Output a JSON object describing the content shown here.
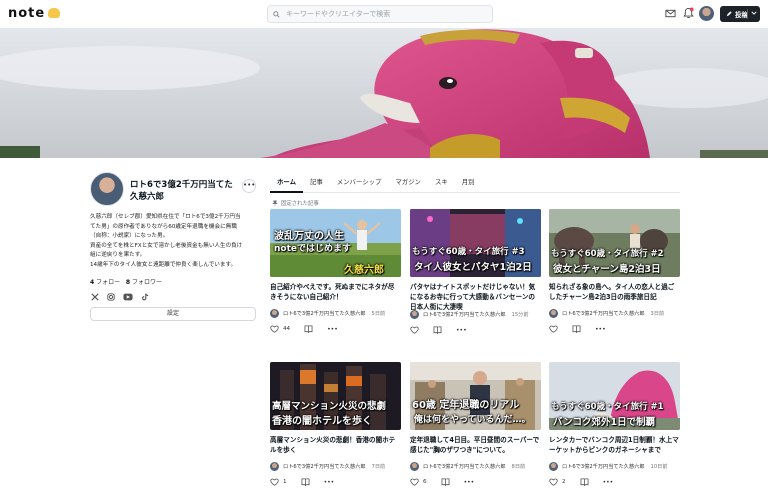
{
  "header": {
    "logo": "note",
    "search_placeholder": "キーワードやクリエイターで検索",
    "post_button": "投稿"
  },
  "profile": {
    "name": "ロト6で3億2千万円当てた久慈六郎",
    "bio": "久慈六郎（セレブ郡）愛知県在住で「ロト6で3億2千万円当\nてた男」の原作者でありながら60歳定年退職を機会に無職\n（自称：小説家）になった男。\n資産の全てを株とFXと女で溶かし老後資金も無い人生の負け\n組に逆戻りを果たす。\n14歳年下のタイ人彼女と遠距離で仲良く楽しんでいます。",
    "follow_count": "4",
    "follow_label": "フォロー",
    "follower_count": "8",
    "follower_label": "フォロワー",
    "settings_button": "設定",
    "social_icons": [
      "x-icon",
      "instagram-icon",
      "youtube-icon",
      "tiktok-icon"
    ]
  },
  "tabs": [
    "ホーム",
    "記事",
    "メンバーシップ",
    "マガジン",
    "スキ",
    "月別"
  ],
  "active_tab": "ホーム",
  "pinned_label": "固定された記事",
  "cards": [
    {
      "thumb_lines": [
        "波乱万丈の人生",
        "noteではじめます",
        "久慈六郎"
      ],
      "title": "自己紹介やべえです。死ぬまでにネタが尽きそうにない自己紹介！",
      "author": "ロト6で3億2千万円当てた久慈六郎",
      "time": "5日前",
      "likes": "44"
    },
    {
      "thumb_lines": [
        "もうすぐ60歳・タイ旅行 #3",
        "タイ人彼女とパタヤ1泊2日"
      ],
      "title": "パタヤはナイトスポットだけじゃない！気になるお寺に行って大感動＆バンセーンの日本人街に大凄喫",
      "author": "ロト6で3億2千万円当てた久慈六郎",
      "time": "15分前",
      "likes": ""
    },
    {
      "thumb_lines": [
        "もうすぐ60歳・タイ旅行 #2",
        "彼女とチャーン島2泊3日"
      ],
      "title": "知られざる象の島へ。タイ人の恋人と過ごしたチャーン島2泊3日の雨季旅日記",
      "author": "ロト6で3億2千万円当てた久慈六郎",
      "time": "3日前",
      "likes": ""
    },
    {
      "thumb_lines": [
        "高層マンション火災の悲劇",
        "香港の闇ホテルを歩く"
      ],
      "title": "高層マンション火災の悲劇！香港の闇ホテルを歩く",
      "author": "ロト6で3億2千万円当てた久慈六郎",
      "time": "7日前",
      "likes": "1"
    },
    {
      "thumb_lines": [
        "60歳 定年退職のリアル",
        "俺は何をやっているんだ…。"
      ],
      "title": "定年退職して4日目。平日昼間のスーパーで感じた\"胸のザワつき\"について。",
      "author": "ロト6で3億2千万円当てた久慈六郎",
      "time": "8日前",
      "likes": "6"
    },
    {
      "thumb_lines": [
        "もうすぐ60歳・タイ旅行 #1",
        "バンコク郊外1日で制覇"
      ],
      "title": "レンタカーでバンコク周辺1日制覇！水上マーケットからピンクのガネーシャまで",
      "author": "ロト6で3億2千万円当てた久慈六郎",
      "time": "10日前",
      "likes": "2"
    }
  ]
}
